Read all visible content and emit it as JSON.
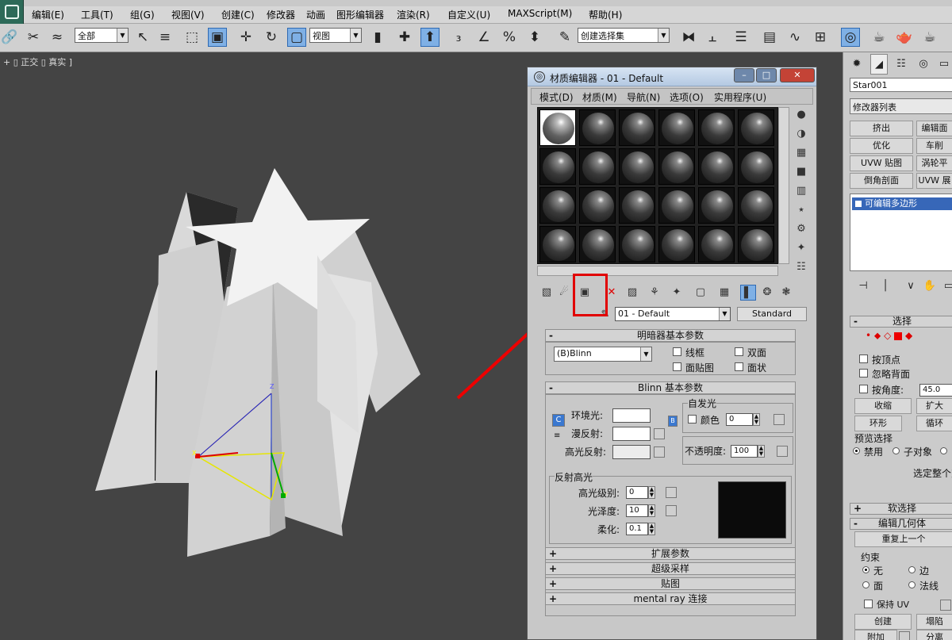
{
  "app": {
    "menu": [
      "编辑(E)",
      "工具(T)",
      "组(G)",
      "视图(V)",
      "创建(C)",
      "修改器",
      "动画",
      "图形编辑器",
      "渲染(R)",
      "自定义(U)",
      "MAXScript(M)",
      "帮助(H)"
    ]
  },
  "toolbar": {
    "selection_filter": "全部",
    "ref_coord": "视图",
    "named_selection": "创建选择集"
  },
  "viewport": {
    "label": "+ ▯ 正交 ▯ 真实 ]",
    "axis_x": "X",
    "axis_y": "Y",
    "axis_z": "Z"
  },
  "material_editor": {
    "title": "材质编辑器 - 01 - Default",
    "menu": [
      "模式(D)",
      "材质(M)",
      "导航(N)",
      "选项(O)",
      "实用程序(U)"
    ],
    "material_name": "01 - Default",
    "material_type": "Standard",
    "shader_rollout": {
      "title": "明暗器基本参数",
      "shader": "(B)Blinn",
      "wire": "线框",
      "two_sided": "双面",
      "face_map": "面贴图",
      "faceted": "面状"
    },
    "blinn_rollout": {
      "title": "Blinn 基本参数",
      "self_illum": "自发光",
      "color_label": "颜色",
      "color_value": "0",
      "ambient": "环境光:",
      "diffuse": "漫反射:",
      "specular": "高光反射:",
      "opacity_label": "不透明度:",
      "opacity_value": "100",
      "ambient_btn": "C",
      "lock_btn": "B"
    },
    "specular_highlights": {
      "title": "反射高光",
      "level_label": "高光级别:",
      "level_value": "0",
      "gloss_label": "光泽度:",
      "gloss_value": "10",
      "soften_label": "柔化:",
      "soften_value": "0.1"
    },
    "collapsed": [
      "扩展参数",
      "超级采样",
      "贴图",
      "mental ray 连接"
    ]
  },
  "command_panel": {
    "object_name": "Star001",
    "modifier_list": "修改器列表",
    "buttons": [
      "挤出",
      "编辑面",
      "优化",
      "车削",
      "UVW 贴图",
      "涡轮平",
      "倒角剖面",
      "UVW 展"
    ],
    "stack_item": "可编辑多边形",
    "selection": {
      "title": "选择",
      "by_vertex": "按顶点",
      "ignore_backfacing": "忽略背面",
      "by_angle": "按角度:",
      "angle_value": "45.0",
      "shrink": "收缩",
      "grow": "扩大",
      "ring": "环形",
      "loop": "循环",
      "preview": "预览选择",
      "disabled": "禁用",
      "subobject": "子对象",
      "selected_whole": "选定整个对"
    },
    "soft_selection": "软选择",
    "edit_geometry": {
      "title": "编辑几何体",
      "repeat_last": "重复上一个",
      "constraints": "约束",
      "none": "无",
      "edge": "边",
      "face": "面",
      "normal": "法线",
      "preserve_uv": "保持 UV",
      "create": "创建",
      "collapse": "塌陷",
      "attach": "附加",
      "detach": "分离"
    }
  }
}
